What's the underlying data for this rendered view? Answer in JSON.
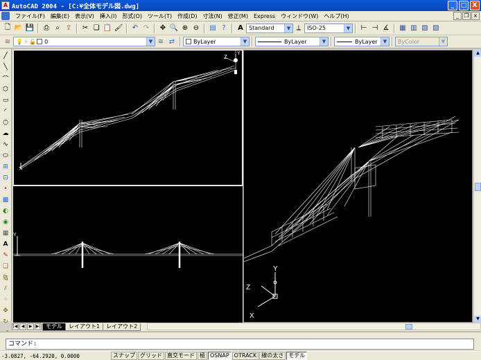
{
  "window": {
    "title": "AutoCAD 2004 - [C:¥全体モデル図.dwg]",
    "app_icon": "A",
    "min_label": "_",
    "max_label": "□",
    "close_label": "X"
  },
  "menu": {
    "items": [
      "ファイル(F)",
      "編集(E)",
      "表示(V)",
      "挿入(I)",
      "形式(O)",
      "ツール(T)",
      "作成(D)",
      "寸法(N)",
      "修正(M)",
      "Express",
      "ウィンドウ(W)",
      "ヘルプ(H)"
    ],
    "doc_min": "_",
    "doc_restore": "❐",
    "doc_close": "x"
  },
  "toolbar": {
    "text_style": "Standard",
    "dim_style": "ISO-25",
    "layer": "0",
    "color": "ByLayer",
    "linetype": "ByLayer",
    "lineweight": "ByLayer",
    "plot_style": "ByColor"
  },
  "tabs": {
    "items": [
      "モデル",
      "レイアウト1",
      "レイアウト2"
    ],
    "active_index": 0
  },
  "command": {
    "prompt": "コマンド:"
  },
  "status": {
    "coords": "-3.0827,  -64.2920, 0.0000",
    "buttons": [
      {
        "label": "スナップ",
        "on": false
      },
      {
        "label": "グリッド",
        "on": false
      },
      {
        "label": "直交モード",
        "on": false
      },
      {
        "label": "極",
        "on": false
      },
      {
        "label": "OSNAP",
        "on": true
      },
      {
        "label": "OTRACK",
        "on": false
      },
      {
        "label": "線の太さ",
        "on": false
      },
      {
        "label": "モデル",
        "on": true
      }
    ]
  },
  "ucs": {
    "x": "X",
    "y": "Y",
    "z": "Z"
  },
  "colors": {
    "titlebar": "#0845b8",
    "viewport_bg": "#000000",
    "drawing": "#ffffff"
  }
}
